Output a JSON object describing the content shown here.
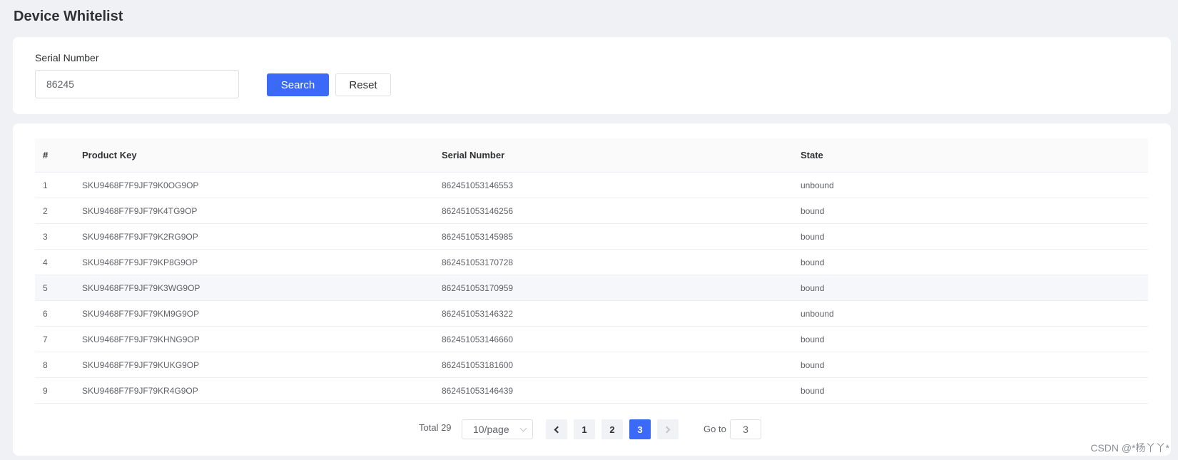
{
  "page_title": "Device Whitelist",
  "search": {
    "label": "Serial Number",
    "value": "86245",
    "search_button": "Search",
    "reset_button": "Reset"
  },
  "table": {
    "headers": [
      "#",
      "Product Key",
      "Serial Number",
      "State"
    ],
    "rows": [
      [
        "1",
        "SKU9468F7F9JF79K0OG9OP",
        "862451053146553",
        "unbound"
      ],
      [
        "2",
        "SKU9468F7F9JF79K4TG9OP",
        "862451053146256",
        "bound"
      ],
      [
        "3",
        "SKU9468F7F9JF79K2RG9OP",
        "862451053145985",
        "bound"
      ],
      [
        "4",
        "SKU9468F7F9JF79KP8G9OP",
        "862451053170728",
        "bound"
      ],
      [
        "5",
        "SKU9468F7F9JF79K3WG9OP",
        "862451053170959",
        "bound"
      ],
      [
        "6",
        "SKU9468F7F9JF79KM9G9OP",
        "862451053146322",
        "unbound"
      ],
      [
        "7",
        "SKU9468F7F9JF79KHNG9OP",
        "862451053146660",
        "bound"
      ],
      [
        "8",
        "SKU9468F7F9JF79KUKG9OP",
        "862451053181600",
        "bound"
      ],
      [
        "9",
        "SKU9468F7F9JF79KR4G9OP",
        "862451053146439",
        "bound"
      ]
    ]
  },
  "pagination": {
    "total_label": "Total 29",
    "page_size": "10/page",
    "pages": [
      "1",
      "2",
      "3"
    ],
    "current_page": "3",
    "goto_label": "Go to",
    "goto_value": "3"
  },
  "watermark": "CSDN @*杨丫丫*",
  "colors": {
    "primary": "#3a6af7",
    "background": "#f0f1f5"
  }
}
